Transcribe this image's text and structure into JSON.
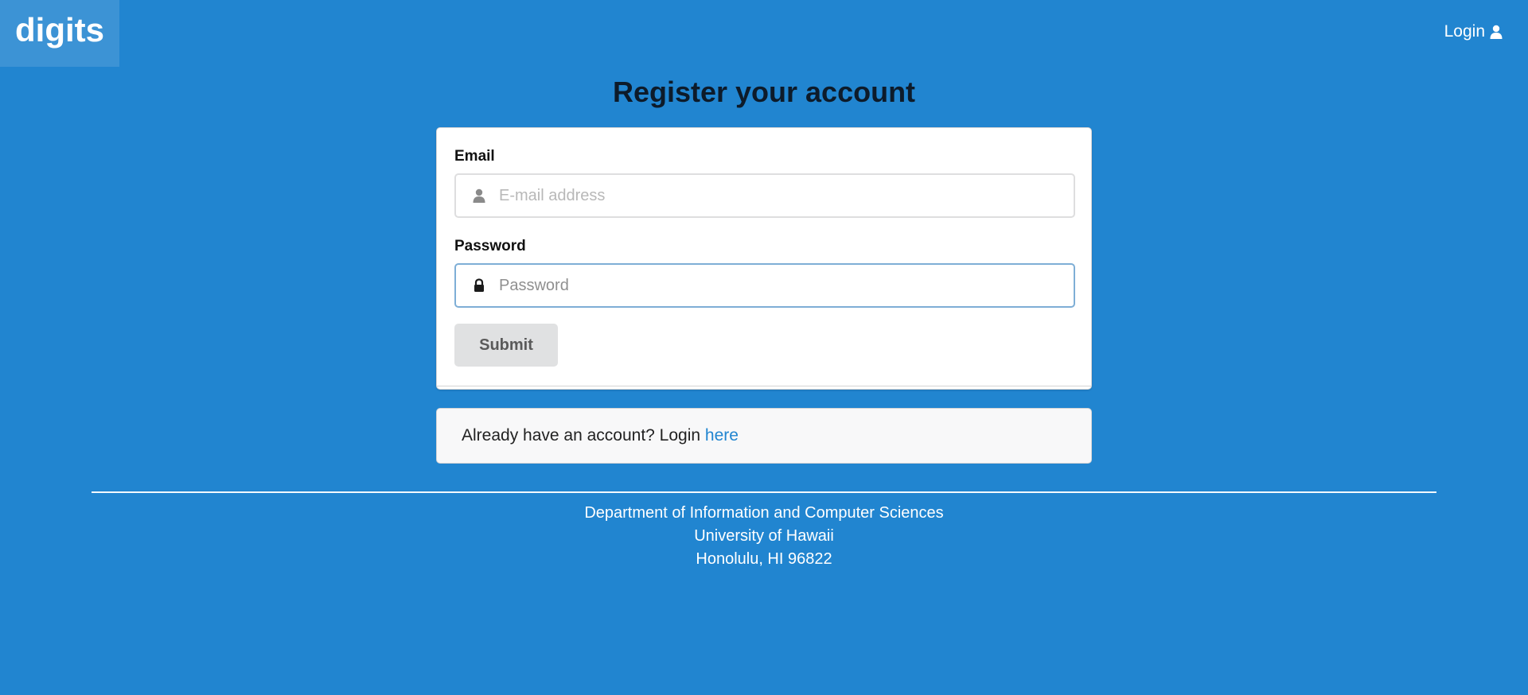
{
  "navbar": {
    "brand": "digits",
    "login_label": "Login",
    "login_icon": "user-icon"
  },
  "page": {
    "title": "Register your account"
  },
  "form": {
    "email_label": "Email",
    "email_placeholder": "E-mail address",
    "email_value": "",
    "email_icon": "user-icon",
    "password_label": "Password",
    "password_placeholder": "Password",
    "password_value": "",
    "password_icon": "lock-icon",
    "submit_label": "Submit"
  },
  "message": {
    "text": "Already have an account? Login ",
    "link_text": "here"
  },
  "footer": {
    "line1": "Department of Information and Computer Sciences",
    "line2": "University of Hawaii",
    "line3": "Honolulu, HI 96822"
  },
  "colors": {
    "background": "#2185d0",
    "link": "#2185d0",
    "button_bg": "#e0e1e2",
    "focus_border": "#7eaed6"
  }
}
